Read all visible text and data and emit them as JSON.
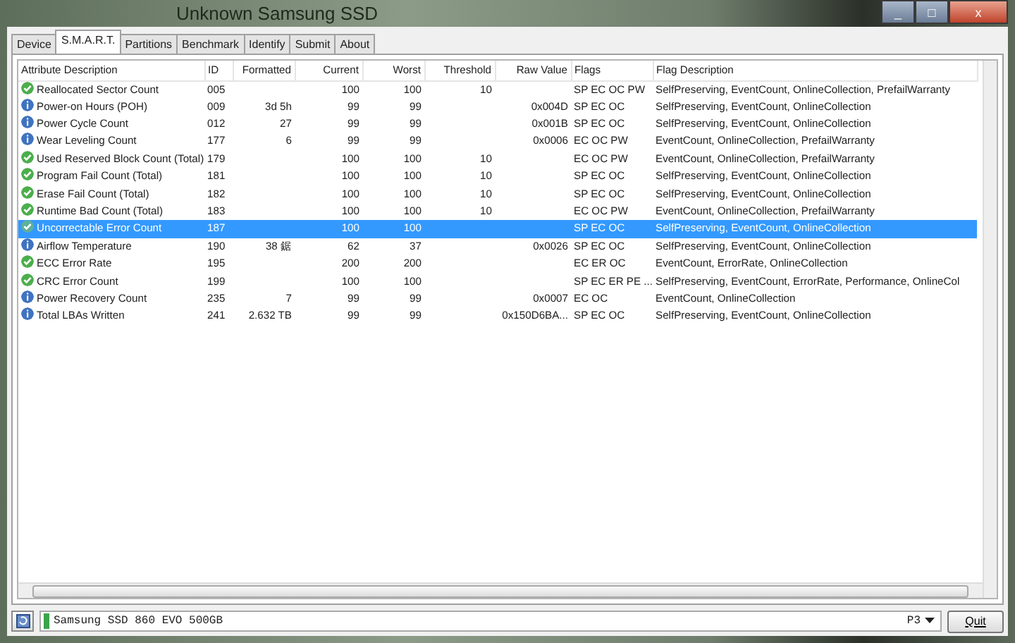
{
  "window": {
    "title": "Unknown Samsung SSD",
    "controls": [
      "_",
      "□",
      "x"
    ]
  },
  "tabs": [
    {
      "label": "Device",
      "selected": false
    },
    {
      "label": "S.M.A.R.T.",
      "selected": true
    },
    {
      "label": "Partitions",
      "selected": false
    },
    {
      "label": "Benchmark",
      "selected": false
    },
    {
      "label": "Identify",
      "selected": false
    },
    {
      "label": "Submit",
      "selected": false
    },
    {
      "label": "About",
      "selected": false
    }
  ],
  "table": {
    "columns": [
      "Attribute Description",
      "ID",
      "Formatted",
      "Current",
      "Worst",
      "Threshold",
      "Raw Value",
      "Flags",
      "Flag Description"
    ],
    "rows": [
      {
        "kind": "ok",
        "selected": false,
        "cells": [
          "Reallocated Sector Count",
          "005",
          "",
          "100",
          "100",
          "10",
          "",
          "SP EC OC PW",
          "SelfPreserving, EventCount, OnlineCollection, PrefailWarranty"
        ]
      },
      {
        "kind": "info",
        "selected": false,
        "cells": [
          "Power-on Hours (POH)",
          "009",
          "3d 5h",
          "99",
          "99",
          "",
          "0x004D",
          "SP EC OC",
          "SelfPreserving, EventCount, OnlineCollection"
        ]
      },
      {
        "kind": "info",
        "selected": false,
        "cells": [
          "Power Cycle Count",
          "012",
          "27",
          "99",
          "99",
          "",
          "0x001B",
          "SP EC OC",
          "SelfPreserving, EventCount, OnlineCollection"
        ]
      },
      {
        "kind": "info",
        "selected": false,
        "cells": [
          "Wear Leveling Count",
          "177",
          "6",
          "99",
          "99",
          "",
          "0x0006",
          "EC OC PW",
          "EventCount, OnlineCollection, PrefailWarranty"
        ]
      },
      {
        "kind": "ok",
        "selected": false,
        "cells": [
          "Used Reserved Block Count (Total)",
          "179",
          "",
          "100",
          "100",
          "10",
          "",
          "EC OC PW",
          "EventCount, OnlineCollection, PrefailWarranty"
        ]
      },
      {
        "kind": "ok",
        "selected": false,
        "cells": [
          "Program Fail Count (Total)",
          "181",
          "",
          "100",
          "100",
          "10",
          "",
          "SP EC OC",
          "SelfPreserving, EventCount, OnlineCollection"
        ]
      },
      {
        "kind": "ok",
        "selected": false,
        "cells": [
          "Erase Fail Count (Total)",
          "182",
          "",
          "100",
          "100",
          "10",
          "",
          "SP EC OC",
          "SelfPreserving, EventCount, OnlineCollection"
        ]
      },
      {
        "kind": "ok",
        "selected": false,
        "cells": [
          "Runtime Bad Count (Total)",
          "183",
          "",
          "100",
          "100",
          "10",
          "",
          "EC OC PW",
          "EventCount, OnlineCollection, PrefailWarranty"
        ]
      },
      {
        "kind": "ok",
        "selected": true,
        "cells": [
          "Uncorrectable Error Count",
          "187",
          "",
          "100",
          "100",
          "",
          "",
          "SP EC OC",
          "SelfPreserving, EventCount, OnlineCollection"
        ]
      },
      {
        "kind": "info",
        "selected": false,
        "cells": [
          "Airflow Temperature",
          "190",
          "38 鋸",
          "62",
          "37",
          "",
          "0x0026",
          "SP EC OC",
          "SelfPreserving, EventCount, OnlineCollection"
        ]
      },
      {
        "kind": "ok",
        "selected": false,
        "cells": [
          "ECC Error Rate",
          "195",
          "",
          "200",
          "200",
          "",
          "",
          "EC ER OC",
          "EventCount, ErrorRate, OnlineCollection"
        ]
      },
      {
        "kind": "ok",
        "selected": false,
        "cells": [
          "CRC Error Count",
          "199",
          "",
          "100",
          "100",
          "",
          "",
          "SP EC ER PE ...",
          "SelfPreserving, EventCount, ErrorRate, Performance, OnlineCol"
        ]
      },
      {
        "kind": "info",
        "selected": false,
        "cells": [
          "Power Recovery Count",
          "235",
          "7",
          "99",
          "99",
          "",
          "0x0007",
          "EC OC",
          "EventCount, OnlineCollection"
        ]
      },
      {
        "kind": "info",
        "selected": false,
        "cells": [
          "Total LBAs Written",
          "241",
          "2.632 TB",
          "99",
          "99",
          "",
          "0x150D6BA...",
          "SP EC OC",
          "SelfPreserving, EventCount, OnlineCollection"
        ]
      }
    ]
  },
  "status_bar": {
    "drive": "Samsung SSD 860 EVO 500GB",
    "port": "P3",
    "quit": "Quit"
  }
}
